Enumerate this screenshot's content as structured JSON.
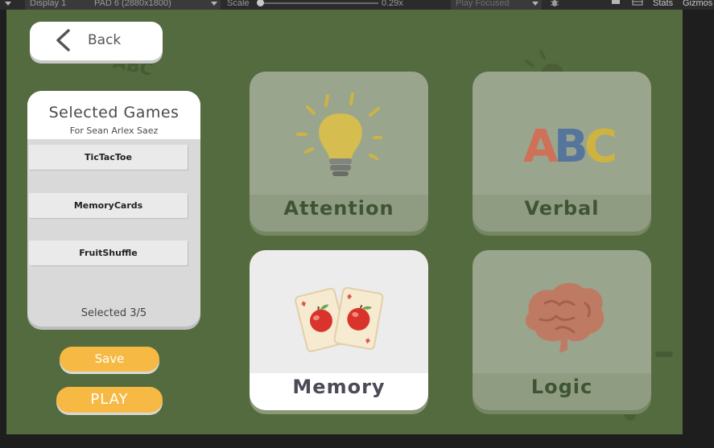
{
  "toolbar": {
    "display": "Display 1",
    "resolution": "PAD 6 (2880x1800)",
    "scale_label": "Scale",
    "scale_value": "0.29x",
    "play_mode": "Play Focused",
    "stats": "Stats",
    "gizmos": "Gizmos"
  },
  "back": {
    "label": "Back"
  },
  "panel": {
    "title": "Selected Games",
    "subtitle": "For Sean Arlex Saez",
    "games": [
      "TicTacToe",
      "MemoryCards",
      "FruitShuffle"
    ],
    "count": "Selected 3/5"
  },
  "actions": {
    "save": "Save",
    "play": "PLAY"
  },
  "categories": [
    {
      "label": "Attention",
      "icon": "lightbulb-icon",
      "active": false
    },
    {
      "label": "Verbal",
      "icon": "abc-icon",
      "active": false,
      "art_text": "ABC"
    },
    {
      "label": "Memory",
      "icon": "memory-cards-icon",
      "active": true
    },
    {
      "label": "Logic",
      "icon": "brain-icon",
      "active": false
    }
  ],
  "decor": {
    "abc": "ABC"
  },
  "colors": {
    "background": "#536b3e",
    "accent": "#f6b944"
  }
}
